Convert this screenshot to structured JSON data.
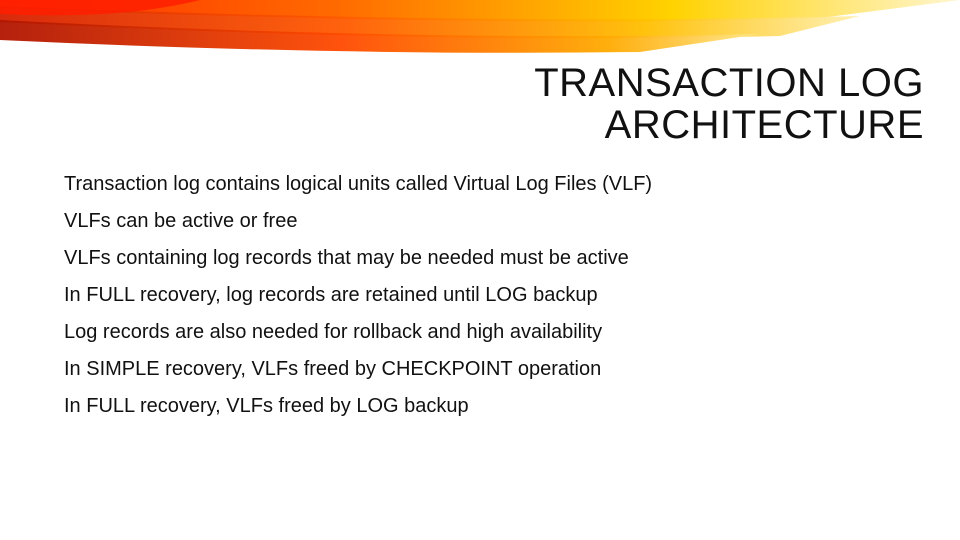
{
  "title_line1": "TRANSACTION LOG",
  "title_line2": "ARCHITECTURE",
  "bullets": [
    "Transaction log contains logical units called Virtual Log Files (VLF)",
    "VLFs can be active or free",
    "VLFs containing log records that may be needed must be active",
    "In FULL recovery, log records are retained until LOG backup",
    "Log records are also needed for rollback and high availability",
    "In SIMPLE recovery, VLFs freed by CHECKPOINT operation",
    "In FULL recovery, VLFs freed by LOG backup"
  ]
}
